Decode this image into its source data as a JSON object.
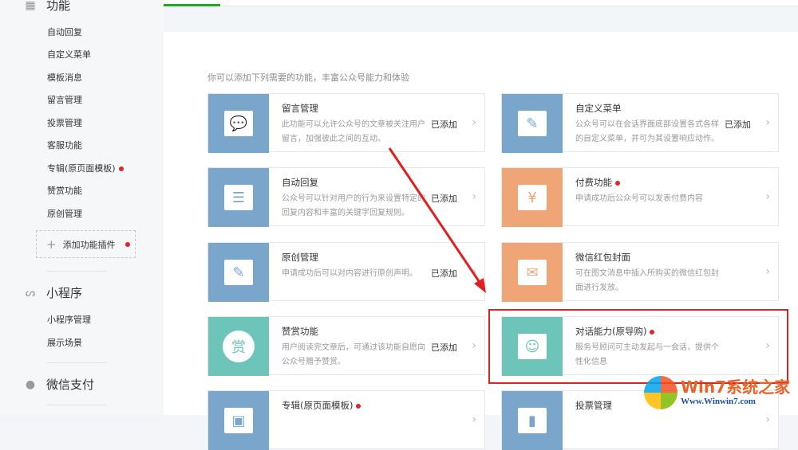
{
  "sidebar": {
    "functions": {
      "title": "功能",
      "items": [
        "自动回复",
        "自定义菜单",
        "模板消息",
        "留言管理",
        "投票管理",
        "客服功能",
        "专辑(原页面模板)",
        "赞赏功能",
        "原创管理"
      ],
      "add_plugin": "添加功能插件"
    },
    "miniprogram": {
      "title": "小程序",
      "items": [
        "小程序管理",
        "展示场景"
      ]
    },
    "pay": {
      "title": "微信支付"
    }
  },
  "main": {
    "intro": "你可以添加下列需要的功能，丰富公众号能力和体验",
    "cards": [
      {
        "title": "留言管理",
        "desc": "此功能可以允许公众号的文章被关注用户留言，加强彼此之间的互动。",
        "status": "已添加",
        "color": "blue",
        "icon": "comment-icon"
      },
      {
        "title": "自定义菜单",
        "desc": "公众号可以在会话界面底部设置各式各样的自定义菜单，并可为其设置响应动作。",
        "status": "已添加",
        "color": "blue",
        "icon": "pencil-icon"
      },
      {
        "title": "自动回复",
        "desc": "公众号可以针对用户的行为来设置特定的回复内容和丰富的关键字回复规则。",
        "status": "已添加",
        "color": "blue",
        "icon": "message-lines-icon"
      },
      {
        "title": "付费功能",
        "desc": "申请成功后公众号可以发表付费内容",
        "status": "",
        "color": "orange",
        "icon": "yen-icon",
        "new": true
      },
      {
        "title": "原创管理",
        "desc": "申请成功后可以对内容进行原创声明。",
        "status": "已添加",
        "color": "blue",
        "icon": "edit-circle-icon"
      },
      {
        "title": "微信红包封面",
        "desc": "可在图文消息中插入所购买的微信红包封面进行发放。",
        "status": "",
        "color": "orange",
        "icon": "red-packet-icon"
      },
      {
        "title": "赞赏功能",
        "desc": "用户阅读完文章后，可通过该功能自愿向公众号赠予赞赏。",
        "status": "已添加",
        "color": "teal",
        "icon": "reward-icon",
        "icon_text": "赏"
      },
      {
        "title": "对话能力(原导购)",
        "desc": "服务号顾问可主动发起与一会话，提供个性化信息",
        "status": "",
        "color": "teal",
        "icon": "chat-smile-icon",
        "new": true
      },
      {
        "title": "专辑(原页面模板)",
        "desc": "",
        "status": "",
        "color": "blue",
        "icon": "album-icon",
        "new": true
      },
      {
        "title": "投票管理",
        "desc": "",
        "status": "",
        "color": "blue",
        "icon": "chart-icon"
      }
    ]
  },
  "watermark": {
    "title": "Win7系统之家",
    "url": "Www.Winwin7.com"
  },
  "colors": {
    "blue": "#7ba6cc",
    "orange": "#f0a577",
    "teal": "#6cc5b8",
    "accent": "#1aad19",
    "annotation": "#e02020"
  }
}
